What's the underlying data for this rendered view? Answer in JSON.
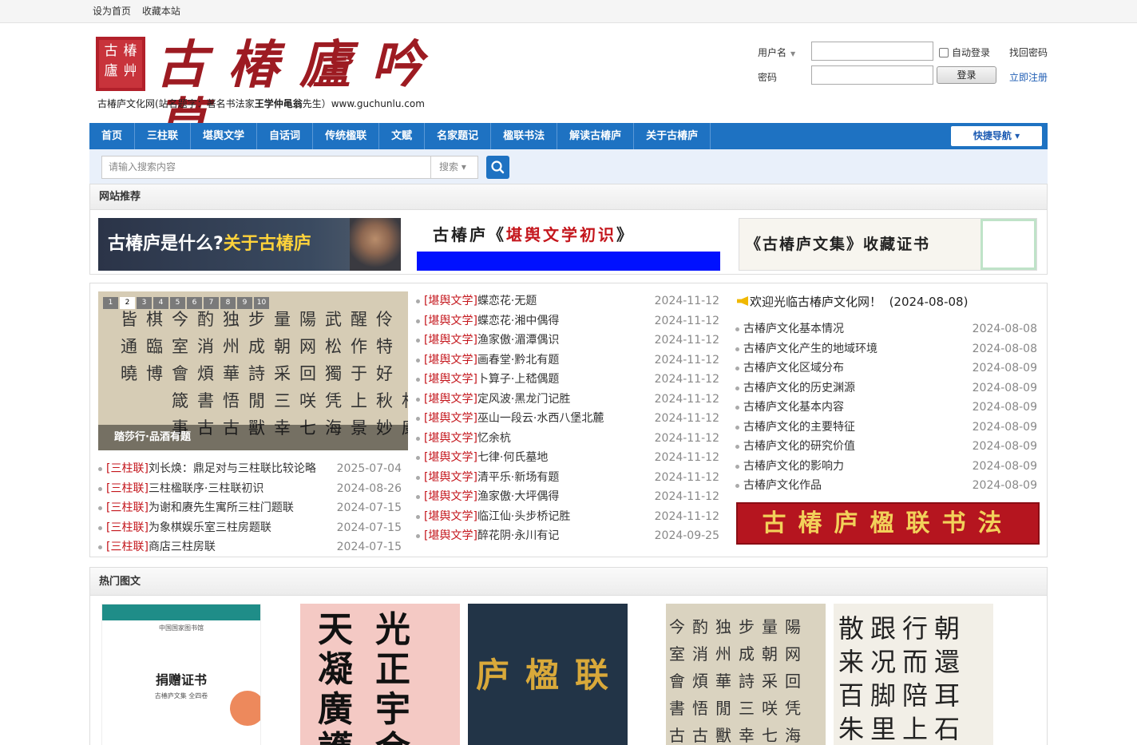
{
  "topbar": {
    "set_home": "设为首页",
    "bookmark": "收藏本站"
  },
  "header": {
    "seal_chars": [
      "古",
      "椿",
      "廬",
      "艸"
    ],
    "logo_text": "古椿廬吟草",
    "tagline_prefix": "古椿庐文化网(站名题字：著名书法家",
    "tagline_bold": "王学仲黾翁",
    "tagline_suffix": "先生）www.guchunlu.com"
  },
  "login": {
    "username_label": "用户名",
    "password_label": "密码",
    "auto_login": "自动登录",
    "login_button": "登录",
    "forgot": "找回密码",
    "register": "立即注册"
  },
  "nav": {
    "items": [
      "首页",
      "三柱联",
      "堪舆文学",
      "自话词",
      "传统楹联",
      "文赋",
      "名家题记",
      "楹联书法",
      "解读古椿庐",
      "关于古椿庐"
    ],
    "quick": "快捷导航 ▾"
  },
  "search": {
    "placeholder": "请输入搜索内容",
    "select": "搜索 ▾"
  },
  "recommend": {
    "heading": "网站推荐",
    "banner1_a": "古椿庐是什么?",
    "banner1_b": "关于古椿庐",
    "banner2_a": "古椿庐《",
    "banner2_b": "堪舆文学初识",
    "banner2_c": "》",
    "banner3": "《古椿庐文集》收藏证书"
  },
  "slider": {
    "pages": [
      "1",
      "2",
      "3",
      "4",
      "5",
      "6",
      "7",
      "8",
      "9",
      "10"
    ],
    "active": "2",
    "caption": "踏莎行·品酒有题",
    "calligraphy": [
      "皆棋今酌独步量陽武醒伶",
      "通臨室消州成朝网松作特",
      "曉博會煩華詩采回獨于好",
      "　　箴書悟閒三咲凭上秋村",
      "　　事古古獸幸七海景妙康"
    ]
  },
  "sanzhu_list": [
    {
      "cat": "[三柱联]",
      "title": "刘长焕：鼎足对与三柱联比较论略",
      "date": "2025-07-04"
    },
    {
      "cat": "[三柱联]",
      "title": "三柱楹联序·三柱联初识",
      "date": "2024-08-26"
    },
    {
      "cat": "[三柱联]",
      "title": "为谢和赓先生寓所三柱门题联",
      "date": "2024-07-15"
    },
    {
      "cat": "[三柱联]",
      "title": "为象棋娱乐室三柱房题联",
      "date": "2024-07-15"
    },
    {
      "cat": "[三柱联]",
      "title": "商店三柱房联",
      "date": "2024-07-15"
    }
  ],
  "kanyu_list": [
    {
      "cat": "[堪舆文学]",
      "title": "蝶恋花·无题",
      "date": "2024-11-12"
    },
    {
      "cat": "[堪舆文学]",
      "title": "蝶恋花·湘中偶得",
      "date": "2024-11-12"
    },
    {
      "cat": "[堪舆文学]",
      "title": "渔家傲·湄潭偶识",
      "date": "2024-11-12"
    },
    {
      "cat": "[堪舆文学]",
      "title": "画春堂·黔北有题",
      "date": "2024-11-12"
    },
    {
      "cat": "[堪舆文学]",
      "title": "卜算子·上嵇偶题",
      "date": "2024-11-12"
    },
    {
      "cat": "[堪舆文学]",
      "title": "定风波·黑龙门记胜",
      "date": "2024-11-12"
    },
    {
      "cat": "[堪舆文学]",
      "title": "巫山一段云·水西八堡北麓",
      "date": "2024-11-12"
    },
    {
      "cat": "[堪舆文学]",
      "title": "忆余杭",
      "date": "2024-11-12"
    },
    {
      "cat": "[堪舆文学]",
      "title": "七律·何氏墓地",
      "date": "2024-11-12"
    },
    {
      "cat": "[堪舆文学]",
      "title": "清平乐·新场有题",
      "date": "2024-11-12"
    },
    {
      "cat": "[堪舆文学]",
      "title": "渔家傲·大坪偶得",
      "date": "2024-11-12"
    },
    {
      "cat": "[堪舆文学]",
      "title": "临江仙·头步桥记胜",
      "date": "2024-11-12"
    },
    {
      "cat": "[堪舆文学]",
      "title": "醉花阴·永川有记",
      "date": "2024-09-25"
    }
  ],
  "notice": {
    "text": "欢迎光临古椿庐文化网！",
    "date": "(2024-08-08)"
  },
  "about_list": [
    {
      "title": "古椿庐文化基本情况",
      "date": "2024-08-08"
    },
    {
      "title": "古椿庐文化产生的地域环境",
      "date": "2024-08-08"
    },
    {
      "title": "古椿庐文化区域分布",
      "date": "2024-08-09"
    },
    {
      "title": "古椿庐文化的历史渊源",
      "date": "2024-08-09"
    },
    {
      "title": "古椿庐文化基本内容",
      "date": "2024-08-09"
    },
    {
      "title": "古椿庐文化的主要特征",
      "date": "2024-08-09"
    },
    {
      "title": "古椿庐文化的研究价值",
      "date": "2024-08-09"
    },
    {
      "title": "古椿庐文化的影响力",
      "date": "2024-08-09"
    },
    {
      "title": "古椿庐文化作品",
      "date": "2024-08-09"
    }
  ],
  "red_banner": "古椿庐楹联书法",
  "hot": {
    "heading": "热门图文",
    "cert_org": "中国国家图书馆",
    "cert_title": "捐赠证书",
    "cert_text": "古椿庐文集 全四卷",
    "t2_text": "天光凝正廣宇護金",
    "t3_text": "庐楹联",
    "t4_text": [
      "今酌独步量陽",
      "室消州成朝网",
      "會煩華詩采回",
      "書悟閒三咲凭",
      "古古獸幸七海"
    ],
    "t5_text": "散跟行朝来况而還百脚陪耳朱里上石全半還缠"
  }
}
